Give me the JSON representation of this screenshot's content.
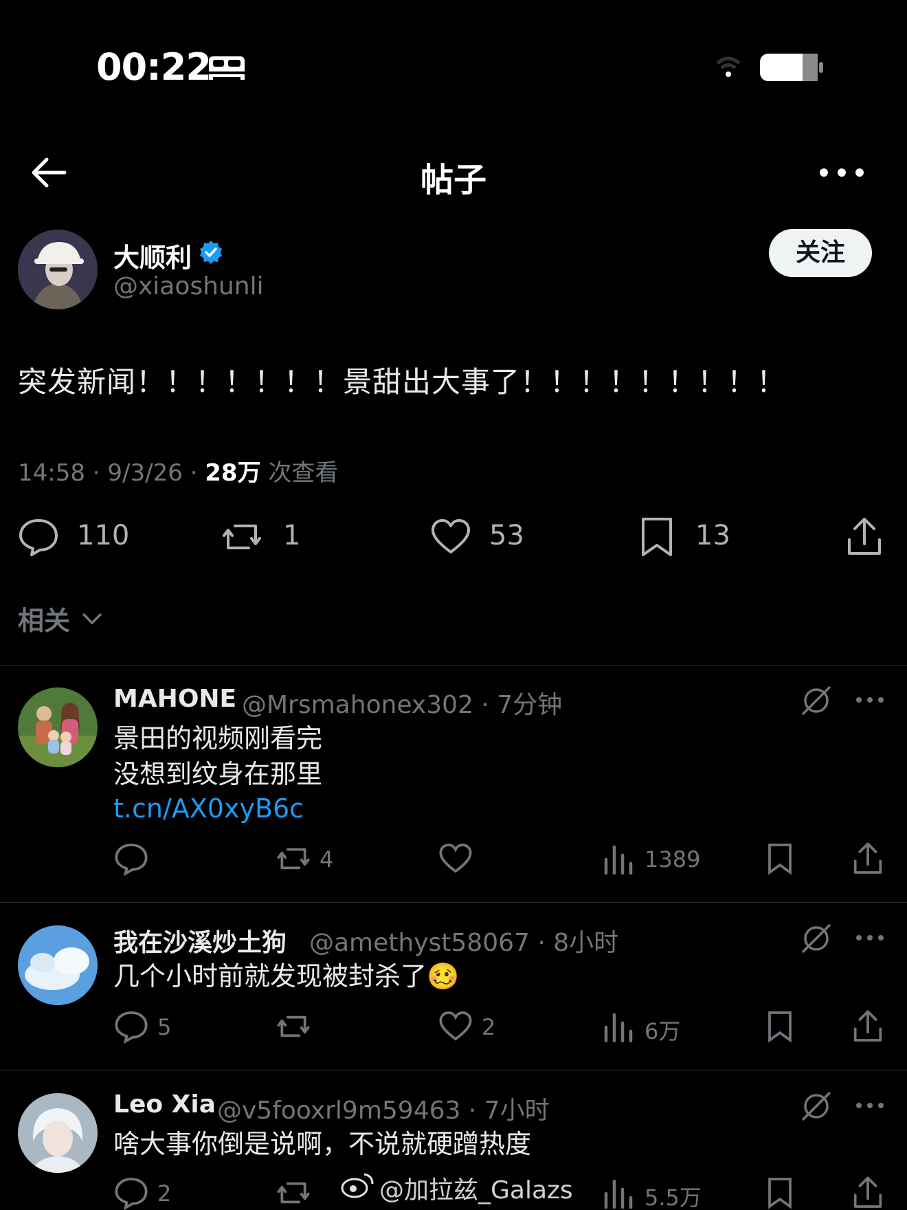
{
  "status_bar": {
    "time": "00:22"
  },
  "header": {
    "title": "帖子"
  },
  "post": {
    "author_name": "大顺利",
    "author_handle": "@xiaoshunli",
    "follow_label": "关注",
    "text": "突发新闻！！！！！！！景甜出大事了！！！！！！！！！",
    "time": "14:58 · 9/3/26 · ",
    "views": "28万",
    "views_label": " 次查看",
    "stats": {
      "replies": "110",
      "reposts": "1",
      "likes": "53",
      "bookmarks": "13"
    }
  },
  "related_label": "相关",
  "replies": [
    {
      "name": "MAHONE",
      "handle": "@Mrsmahonex302",
      "time": "· 7分钟",
      "lines": [
        "景田的视频刚看完",
        "没想到纹身在那里"
      ],
      "link": "t.cn/AX0xyB6c",
      "reply_count": "",
      "repost_count": "4",
      "like_count": "",
      "view_count": "1389"
    },
    {
      "name": "我在沙溪炒土狗",
      "handle": "@amethyst58067",
      "time": "· 8小时",
      "lines": [
        "几个小时前就发现被封杀了"
      ],
      "emoji": "🥴",
      "reply_count": "5",
      "repost_count": "",
      "like_count": "2",
      "view_count": "6万"
    },
    {
      "name": "Leo Xia",
      "handle": "@v5fooxrl9m59463",
      "time": "· 7小时",
      "lines": [
        "啥大事你倒是说啊，不说就硬蹭热度"
      ],
      "reply_count": "2",
      "repost_count": "",
      "like_count": "",
      "view_count": "5.5万"
    }
  ],
  "watermark": "@加拉兹_Galazs",
  "colors": {
    "accent": "#1d9bf0",
    "background": "#000000",
    "muted": "#71767b"
  }
}
